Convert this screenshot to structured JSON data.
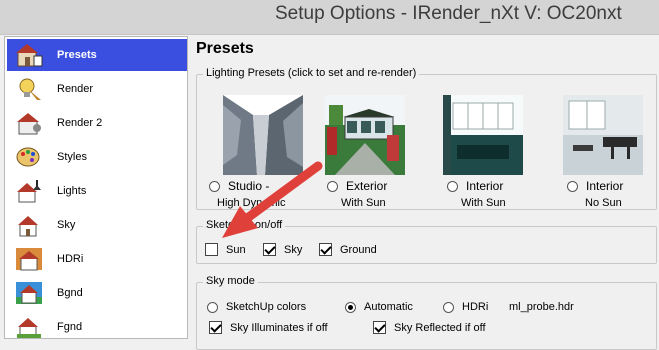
{
  "window": {
    "title": "Setup Options - IRender_nXt V: OC20nxt"
  },
  "sidebar": {
    "items": [
      {
        "label": "Presets",
        "icon": "house-icon"
      },
      {
        "label": "Render",
        "icon": "light-bulb-icon"
      },
      {
        "label": "Render 2",
        "icon": "house-gear-icon"
      },
      {
        "label": "Styles",
        "icon": "paint-palette-icon"
      },
      {
        "label": "Lights",
        "icon": "lamp-house-icon"
      },
      {
        "label": "Sky",
        "icon": "house-sky-icon"
      },
      {
        "label": "HDRi",
        "icon": "house-hdri-icon"
      },
      {
        "label": "Bgnd",
        "icon": "house-background-icon"
      },
      {
        "label": "Fgnd",
        "icon": "house-foreground-icon"
      }
    ],
    "selected": "Presets"
  },
  "main": {
    "title": "Presets",
    "lighting_presets": {
      "legend": "Lighting Presets (click to set and re-render)",
      "presets": [
        {
          "line1": "Studio -",
          "line2": "High Dynamic",
          "selected": false
        },
        {
          "line1": "Exterior",
          "line2": "With Sun",
          "selected": false
        },
        {
          "line1": "Interior",
          "line2": "With Sun",
          "selected": false
        },
        {
          "line1": "Interior",
          "line2": "No Sun",
          "selected": false
        }
      ]
    },
    "sketchup": {
      "legend": "Sketchup on/off",
      "options": [
        {
          "label": "Sun",
          "checked": false
        },
        {
          "label": "Sky",
          "checked": true
        },
        {
          "label": "Ground",
          "checked": true
        }
      ]
    },
    "sky_mode": {
      "legend": "Sky mode",
      "options": [
        {
          "label": "SketchUp colors",
          "selected": false
        },
        {
          "label": "Automatic",
          "selected": true
        },
        {
          "label": "HDRi",
          "selected": false
        }
      ],
      "hdri_file": "ml_probe.hdr",
      "checks": [
        {
          "label": "Sky Illuminates if off",
          "checked": true
        },
        {
          "label": "Sky Reflected if off",
          "checked": true
        }
      ]
    }
  },
  "colors": {
    "selection": "#3a4ee0",
    "arrow": "#e0403a"
  }
}
